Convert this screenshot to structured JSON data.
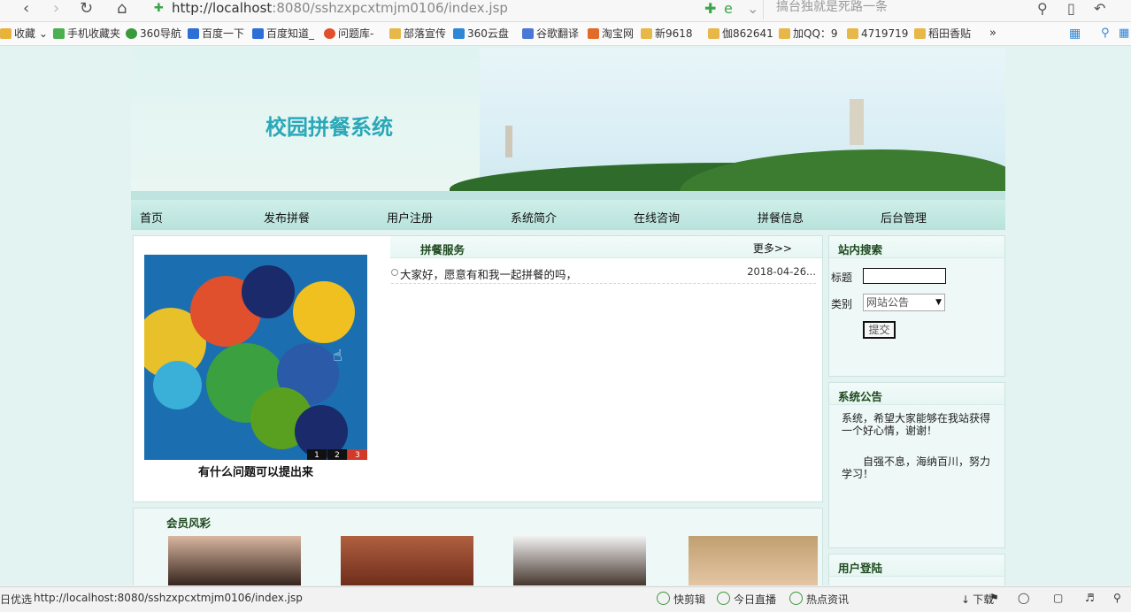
{
  "browser": {
    "url_host": "http://localhost",
    "url_rest": ":8080/sshzxpcxtmjm0106/index.jsp",
    "search_placeholder": "搞台独就是死路一条",
    "bookmarks": [
      "收藏",
      "手机收藏夹",
      "360导航",
      "百度一下",
      "百度知道_",
      "问题库-",
      "部落宣传",
      "360云盘",
      "谷歌翻译",
      "淘宝网",
      "新9618",
      "伽862641",
      "加QQ：9",
      "4719719",
      "稻田香贴"
    ],
    "more": "»"
  },
  "site": {
    "title": "校园拼餐系统",
    "nav": [
      "首页",
      "发布拼餐",
      "用户注册",
      "系统简介",
      "在线咨询",
      "拼餐信息",
      "后台管理"
    ]
  },
  "slideshow": {
    "caption": "有什么问题可以提出来",
    "dots": [
      "1",
      "2",
      "3"
    ],
    "active": 3
  },
  "service": {
    "heading": "拼餐服务",
    "more": "更多>>",
    "items": [
      {
        "title": "大家好，愿意有和我一起拼餐的吗，",
        "date": "2018-04-26..."
      }
    ]
  },
  "search_panel": {
    "heading": "站内搜索",
    "title_label": "标题",
    "title_value": "",
    "type_label": "类别",
    "type_value": "网站公告",
    "submit": "提交"
  },
  "notice": {
    "heading": "系统公告",
    "para1": "系统，希望大家能够在我站获得一个好心情，谢谢！",
    "para2": "自强不息，海纳百川，努力学习！"
  },
  "login": {
    "heading": "用户登陆"
  },
  "members": {
    "heading": "会员风彩"
  },
  "status": {
    "left": "日优选",
    "url": "http://localhost:8080/sshzxpcxtmjm0106/index.jsp",
    "items": [
      "快剪辑",
      "今日直播",
      "热点资讯",
      "下载"
    ]
  }
}
